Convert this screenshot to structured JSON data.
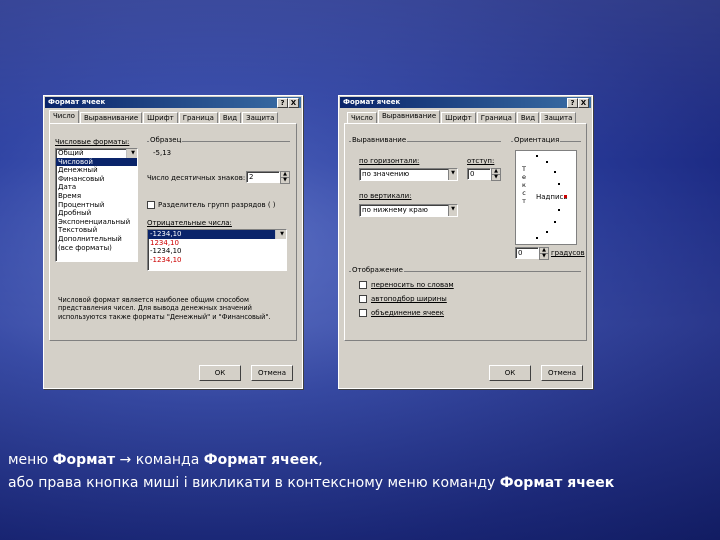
{
  "dialog1": {
    "title": "Формат ячеек",
    "help": "?",
    "close": "X",
    "tabs": [
      "Число",
      "Выравнивание",
      "Шрифт",
      "Граница",
      "Вид",
      "Защита"
    ],
    "formats_label": "Числовые форматы:",
    "formats": [
      "Общий",
      "Числовой",
      "Денежный",
      "Финансовый",
      "Дата",
      "Время",
      "Процентный",
      "Дробный",
      "Экспоненциальный",
      "Текстовый",
      "Дополнительный",
      "(все форматы)"
    ],
    "sample_label": "Образец",
    "sample_value": "-5,13",
    "decimals_label": "Число десятичных знаков:",
    "decimals_value": "2",
    "separator_label": "Разделитель групп разрядов ( )",
    "negative_label": "Отрицательные числа:",
    "negatives": [
      "-1234,10",
      "1234,10",
      "-1234,10",
      "-1234,10"
    ],
    "description": "Числовой формат является наиболее общим способом представления чисел. Для вывода денежных значений используются также форматы \"Денежный\" и \"Финансовый\".",
    "ok": "ОК",
    "cancel": "Отмена"
  },
  "dialog2": {
    "title": "Формат ячеек",
    "help": "?",
    "close": "X",
    "tabs": [
      "Число",
      "Выравнивание",
      "Шрифт",
      "Граница",
      "Вид",
      "Защита"
    ],
    "align_group": "Выравнивание",
    "horiz_label": "по горизонтали:",
    "horiz_value": "по значению",
    "indent_label": "отступ:",
    "indent_value": "0",
    "vert_label": "по вертикали:",
    "vert_value": "по нижнему краю",
    "orient_group": "Ориентация",
    "orient_vertical": [
      "Т",
      "е",
      "к",
      "с",
      "т"
    ],
    "orient_word": "Надпись",
    "degrees_value": "0",
    "degrees_label": "градусов",
    "display_group": "Отображение",
    "wrap_label": "переносить по словам",
    "autofit_label": "автоподбор ширины",
    "merge_label": "объединение ячеек",
    "ok": "ОК",
    "cancel": "Отмена"
  },
  "caption": {
    "line1_pre": "меню ",
    "line1_b1": "Формат",
    "line1_mid": " → команда ",
    "line1_b2": "Формат ячеек",
    "line1_post": ",",
    "line2_pre": "або права кнопка миші і викликати в контексному меню команду ",
    "line2_b": "Формат ячеек"
  },
  "colors": {
    "title_bar": "#0a246a",
    "dialog_bg": "#d4d0c8",
    "negative_red": "#cc0000"
  }
}
